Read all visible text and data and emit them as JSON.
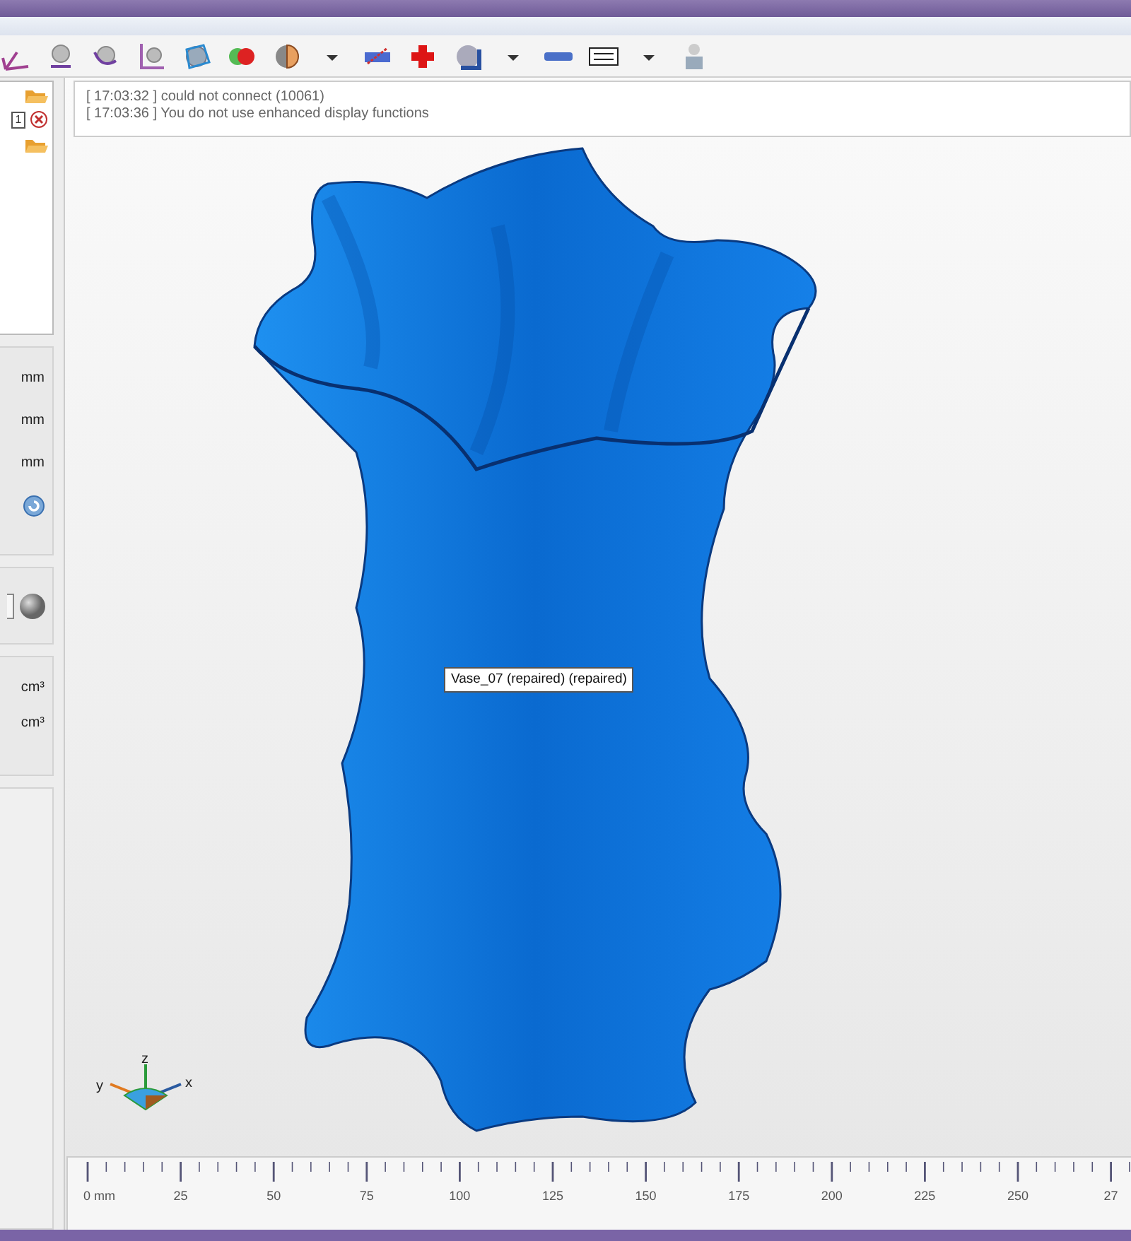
{
  "tree": {
    "item_number": "1"
  },
  "log": [
    "[ 17:03:32 ] could not connect (10061)",
    "[ 17:03:36 ] You do not use enhanced display functions"
  ],
  "size_units": [
    "mm",
    "mm",
    "mm"
  ],
  "area_units": [
    "cm³",
    "cm³"
  ],
  "tooltip": "Vase_07 (repaired) (repaired)",
  "axes": {
    "z": "z",
    "y": "y",
    "x": "x"
  },
  "ruler": {
    "labels": [
      "0 mm",
      "25",
      "50",
      "75",
      "100",
      "125",
      "150",
      "175",
      "200",
      "225",
      "250",
      "27"
    ]
  }
}
